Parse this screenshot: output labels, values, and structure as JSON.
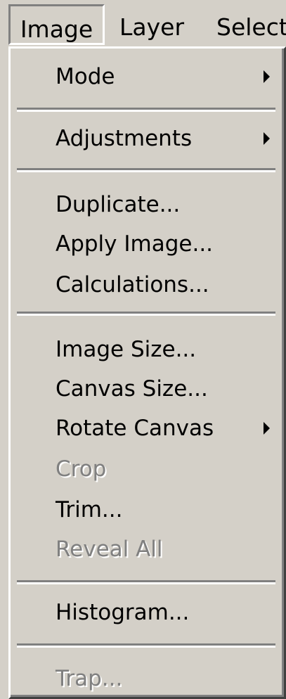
{
  "menubar": {
    "image": "Image",
    "layer": "Layer",
    "select": "Select"
  },
  "menu": {
    "mode": "Mode",
    "adjustments": "Adjustments",
    "duplicate": "Duplicate...",
    "apply_image": "Apply Image...",
    "calculations": "Calculations...",
    "image_size": "Image Size...",
    "canvas_size": "Canvas Size...",
    "rotate_canvas": "Rotate Canvas",
    "crop": "Crop",
    "trim": "Trim...",
    "reveal_all": "Reveal All",
    "histogram": "Histogram...",
    "trap": "Trap..."
  },
  "icons": {
    "submenu": "submenu-arrow-icon"
  },
  "disabled_items": [
    "Crop",
    "Reveal All",
    "Trap..."
  ]
}
